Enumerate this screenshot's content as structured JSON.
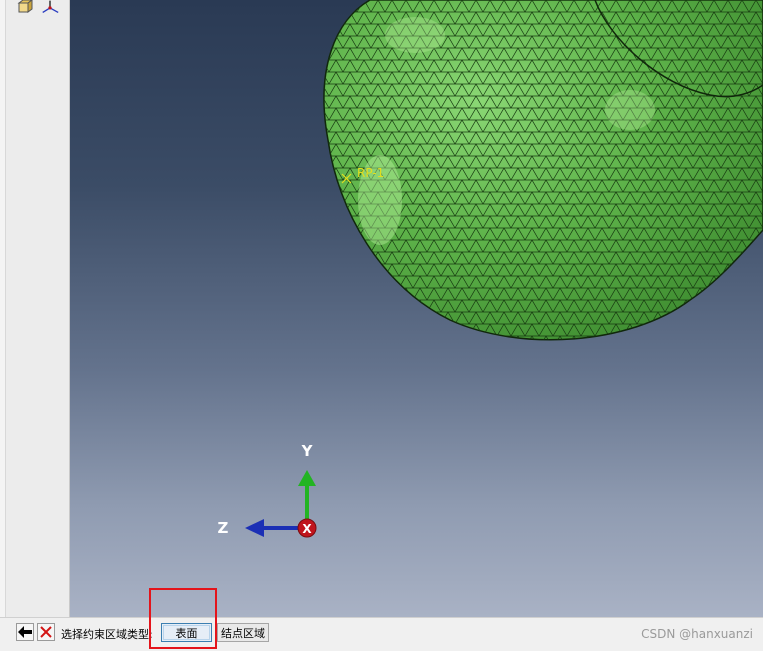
{
  "viewport": {
    "reference_point_label": "RP-1",
    "triad": {
      "y_label": "Y",
      "z_label": "Z",
      "x_label": "X"
    }
  },
  "toolbar_icons": [
    "view-cube-icon",
    "axis-triad-icon"
  ],
  "prompt": {
    "back_icon": "arrow-left-icon",
    "cancel_icon": "cancel-x-icon",
    "text": "选择约束区域类型:",
    "surface_button_label": "表面",
    "node_region_button_label": "结点区域"
  },
  "watermark": "CSDN @hanxuanzi",
  "colors": {
    "mesh_fill": "#5fb34a",
    "mesh_lines": "#1b3a12",
    "reference_point": "#e3de1d",
    "y_axis": "#22b422",
    "z_axis": "#1b2fb5",
    "x_axis": "#c0141c",
    "highlight": "#e4141b"
  }
}
